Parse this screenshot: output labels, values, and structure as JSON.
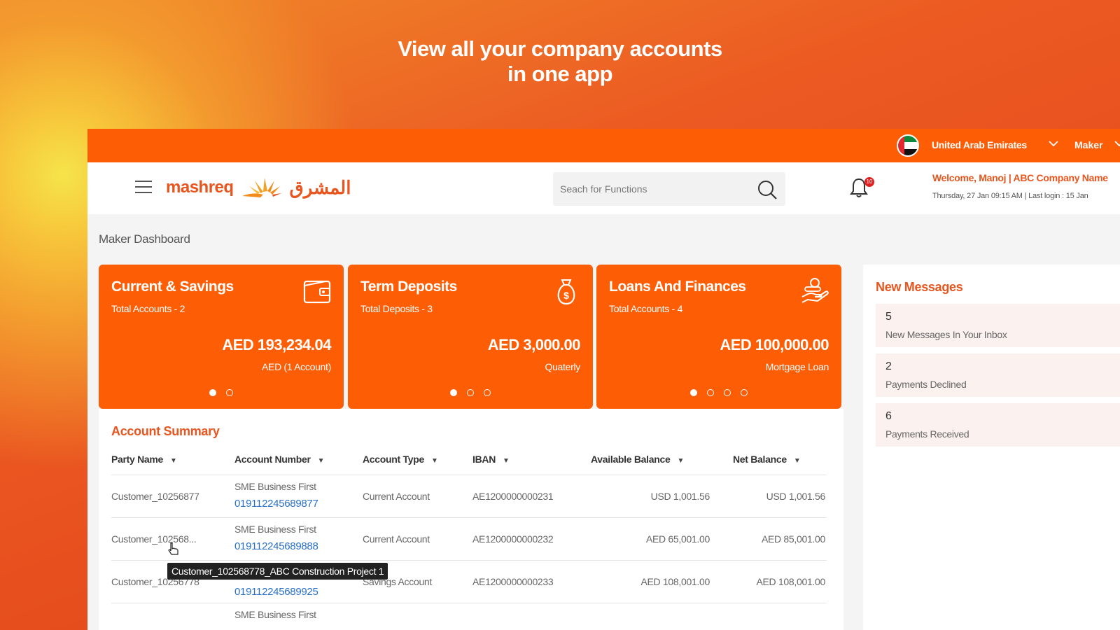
{
  "headline": {
    "line1": "View all your company accounts",
    "line2": "in one app"
  },
  "topbar": {
    "country": "United Arab Emirates",
    "role": "Maker"
  },
  "header": {
    "logo_en": "mashreq",
    "logo_ar": "المشرق",
    "search_placeholder": "Seach for Functions",
    "notification_count": "10",
    "welcome": "Welcome, Manoj | ABC Company Name",
    "last_login": "Thursday, 27 Jan 09:15 AM  |  Last login : 15 Jan"
  },
  "breadcrumb": "Maker Dashboard",
  "cards": [
    {
      "title": "Current & Savings",
      "subtitle": "Total Accounts - 2",
      "amount": "AED 193,234.04",
      "note": "AED (1 Account)",
      "icon": "wallet-icon"
    },
    {
      "title": "Term Deposits",
      "subtitle": "Total Deposits - 3",
      "amount": "AED 3,000.00",
      "note": "Quaterly",
      "icon": "money-bag-icon"
    },
    {
      "title": "Loans And Finances",
      "subtitle": "Total Accounts - 4",
      "amount": "AED 100,000.00",
      "note": "Mortgage Loan",
      "icon": "hand-coin-icon"
    }
  ],
  "summary": {
    "title": "Account Summary",
    "columns": [
      "Party Name",
      "Account Number",
      "Account Type",
      "IBAN",
      "Available Balance",
      "Net Balance"
    ],
    "rows": [
      {
        "party": "Customer_10256877",
        "product": "SME Business First",
        "number": "019112245689877",
        "type": "Current Account",
        "iban": "AE1200000000231",
        "available": "USD 1,001.56",
        "net": "USD 1,001.56"
      },
      {
        "party": "Customer_102568...",
        "product": "SME Business First",
        "number": "019112245689888",
        "type": "Current Account",
        "iban": "AE1200000000232",
        "available": "AED 65,001.00",
        "net": "AED 85,001.00"
      },
      {
        "party": "Customer_10256778",
        "product": "",
        "number": "019112245689925",
        "type": "Savings Account",
        "iban": "AE1200000000233",
        "available": "AED 108,001.00",
        "net": "AED 108,001.00"
      },
      {
        "party": "",
        "product": "SME Business First",
        "number": "",
        "type": "",
        "iban": "",
        "available": "",
        "net": ""
      }
    ],
    "tooltip": "Customer_102568778_ABC Construction Project 1"
  },
  "messages": {
    "title": "New Messages",
    "items": [
      {
        "count": "5",
        "label": "New Messages In Your Inbox"
      },
      {
        "count": "2",
        "label": "Payments Declined"
      },
      {
        "count": "6",
        "label": "Payments Received"
      }
    ]
  }
}
